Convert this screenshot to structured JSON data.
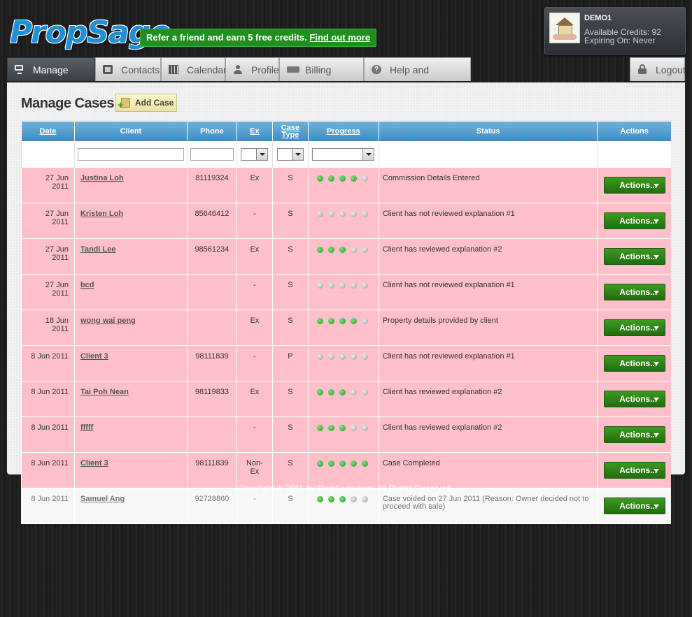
{
  "header": {
    "logo_text": "PropSage",
    "refer_text": "Refer a friend and earn 5 free credits.",
    "refer_link": "Find out more"
  },
  "user": {
    "name": "DEMO1",
    "credits": "Available Credits: 92",
    "expiring": "Expiring On: Never"
  },
  "tabs": [
    {
      "label": "Manage Cases",
      "icon": "monitor-icon"
    },
    {
      "label": "Contacts",
      "icon": "contacts-icon"
    },
    {
      "label": "Calendar",
      "icon": "calendar-icon"
    },
    {
      "label": "Profile",
      "icon": "profile-icon"
    },
    {
      "label": "Billing History",
      "icon": "billing-icon"
    },
    {
      "label": "Help and Feedback",
      "icon": "help-icon"
    }
  ],
  "logout_label": "Logout",
  "page": {
    "title": "Manage Cases",
    "add_button": "Add Case"
  },
  "table": {
    "columns": [
      "Date",
      "Client",
      "Phone",
      "Ex",
      "Case Type",
      "Progress",
      "Status",
      "Actions"
    ],
    "action_label": "Actions...",
    "rows": [
      {
        "date": "27 Jun 2011",
        "client": "Justina Loh",
        "phone": "81119324",
        "ex": "Ex",
        "type": "S",
        "progress": 4,
        "status": "Commission Details Entered",
        "voided": false
      },
      {
        "date": "27 Jun 2011",
        "client": "Kristen Loh",
        "phone": "85646412",
        "ex": "-",
        "type": "S",
        "progress": 0,
        "status": "Client has not reviewed explanation #1",
        "voided": false
      },
      {
        "date": "27 Jun 2011",
        "client": "Tandi Lee",
        "phone": "98561234",
        "ex": "Ex",
        "type": "S",
        "progress": 3,
        "status": "Client has reviewed explanation #2",
        "voided": false
      },
      {
        "date": "27 Jun 2011",
        "client": "bcd",
        "phone": "",
        "ex": "-",
        "type": "S",
        "progress": 0,
        "status": "Client has not reviewed explanation #1",
        "voided": false
      },
      {
        "date": "18 Jun 2011",
        "client": "wong wai peng",
        "phone": "",
        "ex": "Ex",
        "type": "S",
        "progress": 4,
        "status": "Property details provided by client",
        "voided": false
      },
      {
        "date": "8 Jun 2011",
        "client": "Client 3",
        "phone": "98111839",
        "ex": "-",
        "type": "P",
        "progress": 0,
        "status": "Client has not reviewed explanation #1",
        "voided": false
      },
      {
        "date": "8 Jun 2011",
        "client": "Tai Poh Nean",
        "phone": "98119833",
        "ex": "Ex",
        "type": "S",
        "progress": 3,
        "status": "Client has reviewed explanation #2",
        "voided": false
      },
      {
        "date": "8 Jun 2011",
        "client": "fffff",
        "phone": "",
        "ex": "-",
        "type": "S",
        "progress": 3,
        "status": "Client has reviewed explanation #2",
        "voided": false
      },
      {
        "date": "8 Jun 2011",
        "client": "Client 3",
        "phone": "98111839",
        "ex": "Non-Ex",
        "type": "S",
        "progress": 5,
        "status": "Case Completed",
        "voided": false
      },
      {
        "date": "8 Jun 2011",
        "client": "Samuel Ang",
        "phone": "92728860",
        "ex": "-",
        "type": "S",
        "progress": 3,
        "status": "Case voided on 27 Jun 2011 (Reason: Owner decided not to proceed with sale)",
        "voided": true
      }
    ]
  },
  "footer": "Copyright © 2011 by PropSage.com. All Rights Reserved."
}
